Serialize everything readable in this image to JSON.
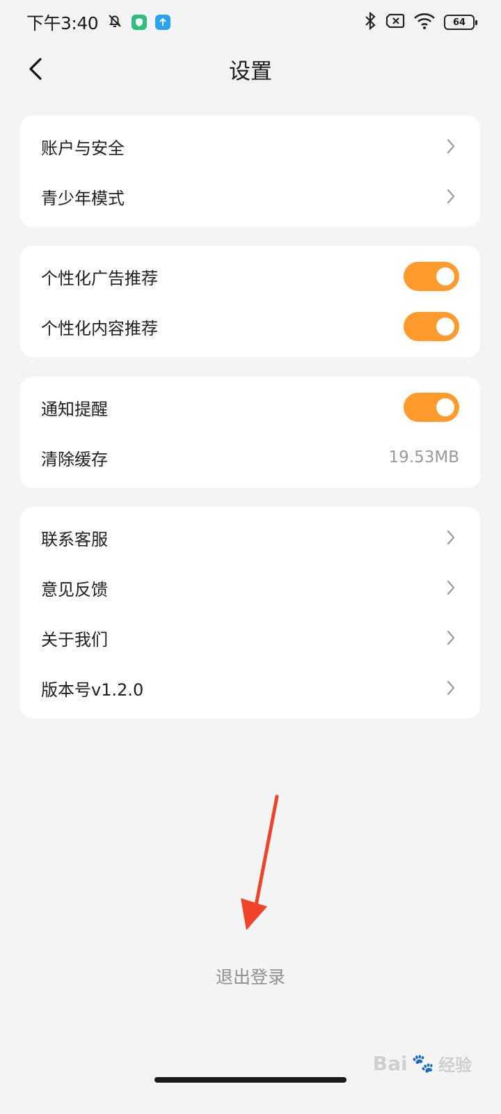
{
  "status_bar": {
    "time": "下午3:40",
    "battery": "64",
    "icons": [
      "mute-bell-icon",
      "shield-app-icon",
      "upload-app-icon",
      "bluetooth-icon",
      "sim-x-icon",
      "wifi-icon",
      "battery-icon"
    ]
  },
  "header": {
    "title": "设置"
  },
  "groups": {
    "account": [
      {
        "label": "账户与安全",
        "icon": "chevron-right-icon"
      },
      {
        "label": "青少年模式",
        "icon": "chevron-right-icon"
      }
    ],
    "personalization": [
      {
        "label": "个性化广告推荐",
        "toggle": "on"
      },
      {
        "label": "个性化内容推荐",
        "toggle": "on"
      }
    ],
    "notifications": [
      {
        "label": "通知提醒",
        "toggle": "on"
      },
      {
        "label": "清除缓存",
        "value": "19.53MB"
      }
    ],
    "support": [
      {
        "label": "联系客服",
        "icon": "chevron-right-icon"
      },
      {
        "label": "意见反馈",
        "icon": "chevron-right-icon"
      },
      {
        "label": "关于我们",
        "icon": "chevron-right-icon"
      },
      {
        "label": "版本号v1.2.0",
        "icon": "chevron-right-icon"
      }
    ]
  },
  "footer": {
    "logout": "退出登录"
  },
  "watermark": {
    "brand": "Bai",
    "suffix": "经验"
  },
  "colors": {
    "accent": "#ff9a2d",
    "annotation": "#f0432a",
    "background": "#f4f4f4"
  }
}
